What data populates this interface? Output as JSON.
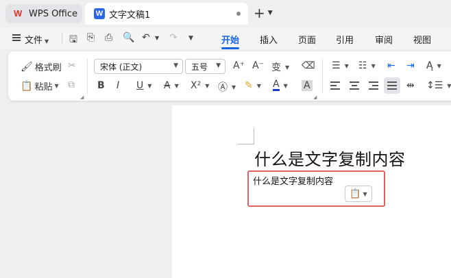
{
  "tabs": {
    "home_tab": "WPS Office",
    "doc_tab": "文字文稿1"
  },
  "menu": {
    "file": "文件",
    "ribbon_tabs": [
      "开始",
      "插入",
      "页面",
      "引用",
      "审阅",
      "视图"
    ]
  },
  "ribbon": {
    "format_painter": "格式刷",
    "paste": "粘贴",
    "font_name": "宋体 (正文)",
    "font_size": "五号"
  },
  "document": {
    "heading": "什么是文字复制内容",
    "pasted_text": "什么是文字复制内容"
  },
  "colors": {
    "accent": "#1766e8",
    "highlight_box": "#e06060",
    "wps_logo": "#e7302a"
  }
}
